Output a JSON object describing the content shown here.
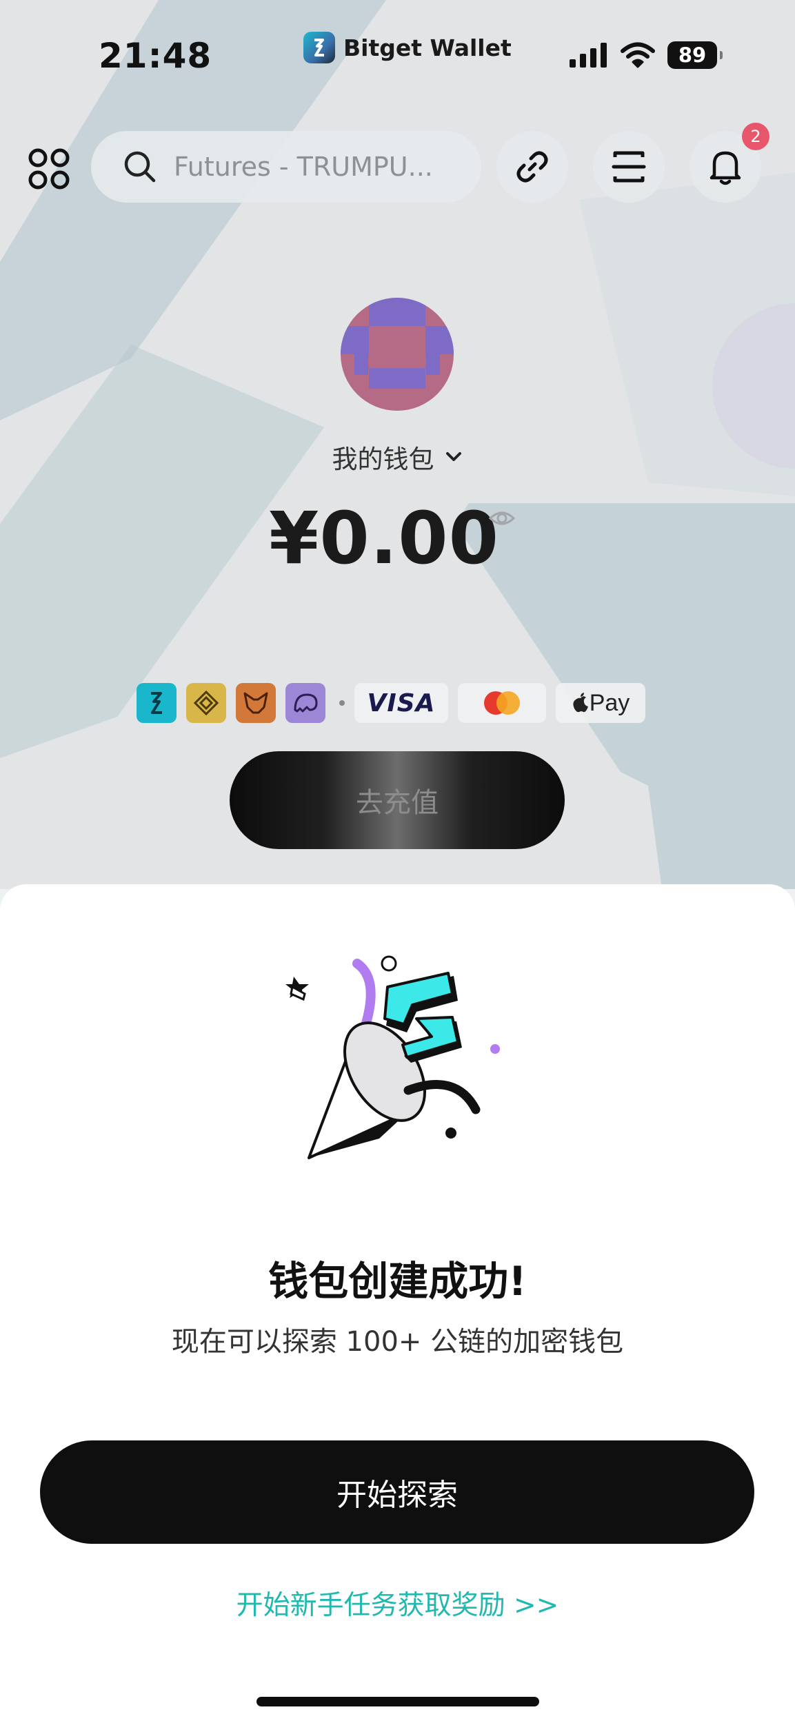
{
  "status_bar": {
    "time": "21:48",
    "app_name": "Bitget Wallet",
    "battery": "89",
    "icons": [
      "cellular-signal-icon",
      "wifi-icon",
      "battery-icon"
    ]
  },
  "top_bar": {
    "search_placeholder": "Futures - TRUMPU...",
    "icons": [
      "apps-grid-icon",
      "search-icon",
      "link-icon",
      "scan-icon",
      "bell-icon"
    ],
    "notification_count": "2"
  },
  "wallet": {
    "name": "我的钱包",
    "balance": "¥0.00"
  },
  "payment_methods": {
    "apps": [
      "bitget-wallet-icon",
      "binance-icon",
      "metamask-icon",
      "phantom-icon"
    ],
    "cards": {
      "visa": "VISA",
      "mastercard": "mastercard-icon",
      "apple_pay": "Pay"
    }
  },
  "topup_button": "去充值",
  "sheet": {
    "title": "钱包创建成功!",
    "subtitle": "现在可以探索 100+ 公链的加密钱包",
    "primary_button": "开始探索",
    "reward_link": "开始新手任务获取奖励 >>"
  },
  "colors": {
    "accent_cyan": "#3de8e8",
    "accent_purple": "#b07cf0",
    "link_teal": "#21b8b0",
    "button_black": "#0f0f10",
    "badge_red": "#e8566c"
  }
}
